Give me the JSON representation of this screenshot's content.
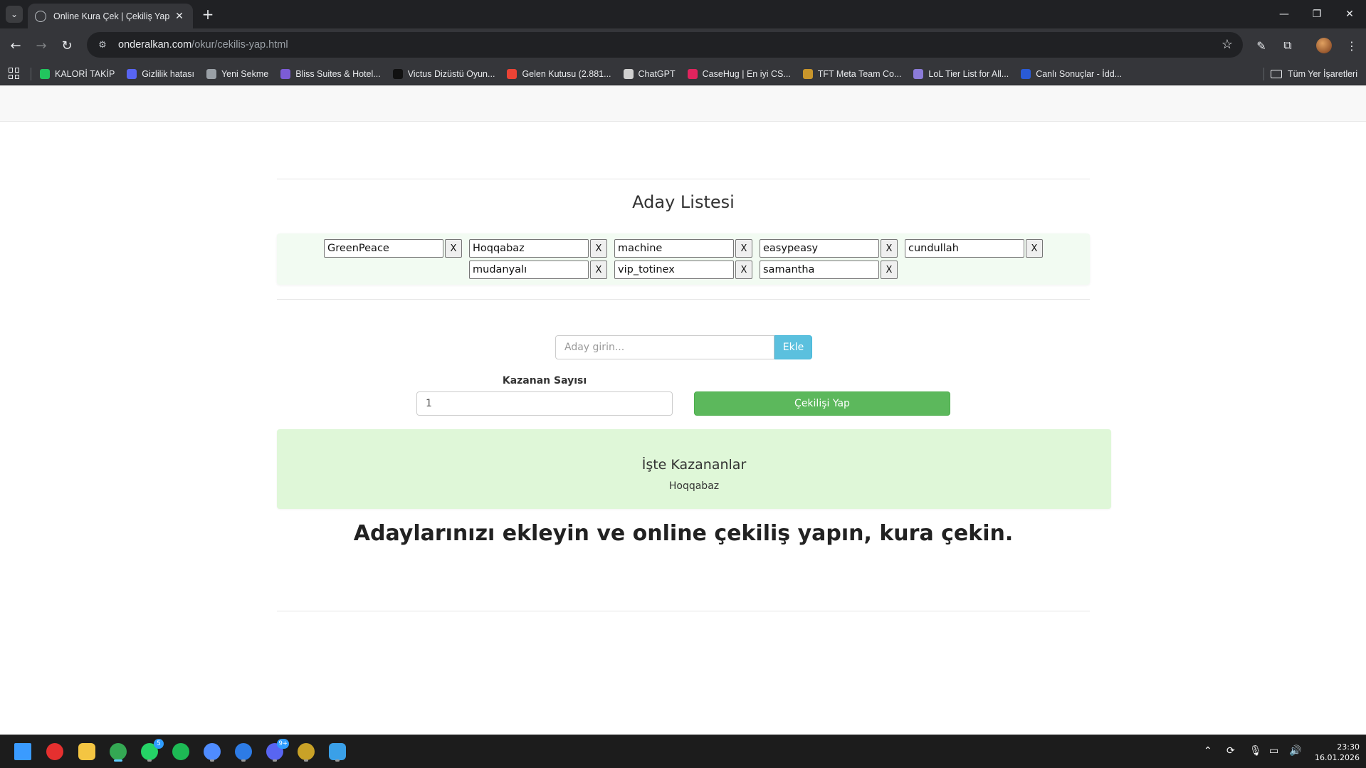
{
  "browser": {
    "tab_title": "Online Kura Çek | Çekiliş Yap",
    "url_host": "onderalkan.com",
    "url_path": "/okur/cekilis-yap.html",
    "bookmarks": [
      {
        "label": "KALORİ TAKİP",
        "icon": "green-plus-icon",
        "color": "#22c55e"
      },
      {
        "label": "Gizlilik hatası",
        "icon": "discord-icon",
        "color": "#5865f2"
      },
      {
        "label": "Yeni Sekme",
        "icon": "globe-icon",
        "color": "#9aa0a6"
      },
      {
        "label": "Bliss Suites & Hotel...",
        "icon": "hotel-icon",
        "color": "#7c5cd6"
      },
      {
        "label": "Victus Dizüstü Oyun...",
        "icon": "hp-icon",
        "color": "#111111"
      },
      {
        "label": "Gelen Kutusu (2.881...",
        "icon": "gmail-icon",
        "color": "#ea4335"
      },
      {
        "label": "ChatGPT",
        "icon": "chatgpt-icon",
        "color": "#d0d0d0"
      },
      {
        "label": "CaseHug | En iyi CS...",
        "icon": "casehug-icon",
        "color": "#e0245e"
      },
      {
        "label": "TFT Meta Team Co...",
        "icon": "tft-icon",
        "color": "#c8952b"
      },
      {
        "label": "LoL Tier List for All...",
        "icon": "shield-icon",
        "color": "#8b7bd8"
      },
      {
        "label": "Canlı Sonuçlar - İdd...",
        "icon": "mackolik-icon",
        "color": "#2a5bd7"
      }
    ],
    "all_bookmarks_label": "Tüm Yer İşaretleri"
  },
  "page": {
    "section_title": "Aday Listesi",
    "candidates": [
      "GreenPeace",
      "Hoqqabaz",
      "machine",
      "easypeasy",
      "cundullah",
      "mudanyalı",
      "vip_totinex",
      "samantha"
    ],
    "remove_label": "X",
    "add_placeholder": "Aday girin...",
    "add_button": "Ekle",
    "winners_count_label": "Kazanan Sayısı",
    "winners_count_value": "1",
    "draw_button": "Çekilişi Yap",
    "result_title": "İşte Kazananlar",
    "result_winner": "Hoqqabaz",
    "headline": "Adaylarınızı ekleyin ve online çekiliş yapın, kura çekin."
  },
  "taskbar": {
    "apps": [
      {
        "name": "start-icon",
        "color": "#3a9bff"
      },
      {
        "name": "app-red-icon",
        "color": "#e5302f"
      },
      {
        "name": "file-explorer-icon",
        "color": "#f4c542"
      },
      {
        "name": "chrome-icon",
        "color": "#34a853"
      },
      {
        "name": "whatsapp-icon",
        "color": "#25d366",
        "badge": "5"
      },
      {
        "name": "spotify-icon",
        "color": "#1db954"
      },
      {
        "name": "game-launcher-icon",
        "color": "#4f8cff"
      },
      {
        "name": "blue-app-icon",
        "color": "#2d7be5"
      },
      {
        "name": "discord-icon",
        "color": "#5865f2",
        "badge": "9+"
      },
      {
        "name": "g-app-icon",
        "color": "#c9a227"
      },
      {
        "name": "photos-icon",
        "color": "#3aa0e8"
      }
    ],
    "time": "23:30",
    "date": "16.01.2026"
  }
}
